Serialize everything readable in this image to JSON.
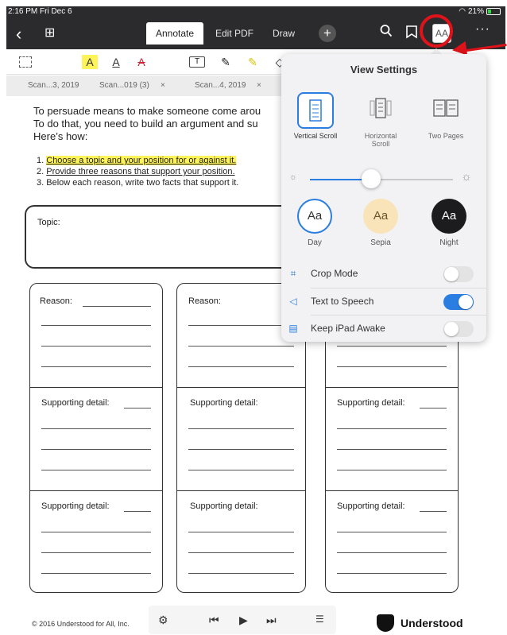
{
  "status": {
    "time": "2:16 PM  Fri Dec 6",
    "battery": "21%"
  },
  "nav": {
    "back": "‹",
    "grid": "⊞",
    "tabs": [
      "Annotate",
      "Edit PDF",
      "Draw"
    ],
    "plus": "+",
    "text_size_button": "AA",
    "more": "···"
  },
  "doc_tabs": [
    "Scan...3, 2019",
    "Scan...019 (3)",
    "×",
    "Scan...4, 2019",
    "×"
  ],
  "document": {
    "para": [
      "To persuade means to make someone come arou",
      "To do that, you need to build an argument and su",
      "Here’s how:"
    ],
    "list": [
      {
        "n": "1.",
        "text": "Choose a topic and your position for or against it."
      },
      {
        "n": "2.",
        "text": "Provide three reasons that support your position."
      },
      {
        "n": "3.",
        "text": "Below each reason, write two facts that support it."
      }
    ],
    "topic_label": "Topic:",
    "reason_label": "Reason:",
    "detail_label": "Supporting detail:"
  },
  "popover": {
    "title": "View Settings",
    "scroll_options": [
      {
        "label": "Vertical Scroll",
        "selected": true
      },
      {
        "label": "Horizontal Scroll",
        "selected": false
      },
      {
        "label": "Two Pages",
        "selected": false
      }
    ],
    "brightness": 0.43,
    "themes": [
      {
        "label": "Day",
        "text": "Aa",
        "bg": "#ffffff",
        "fg": "#333333",
        "selected": true
      },
      {
        "label": "Sepia",
        "text": "Aa",
        "bg": "#f8e4b8",
        "fg": "#6b5530",
        "selected": false
      },
      {
        "label": "Night",
        "text": "Aa",
        "bg": "#1c1c1e",
        "fg": "#ffffff",
        "selected": false
      }
    ],
    "toggles": [
      {
        "label": "Crop Mode",
        "on": false
      },
      {
        "label": "Text to Speech",
        "on": true
      },
      {
        "label": "Keep iPad Awake",
        "on": false
      }
    ]
  },
  "footer": {
    "copyright": "© 2016 Understood for All, Inc.",
    "brand": "Understood"
  },
  "colors": {
    "accent": "#2a7de1",
    "highlight": "#fff35a",
    "annotation": "#e0121a"
  }
}
